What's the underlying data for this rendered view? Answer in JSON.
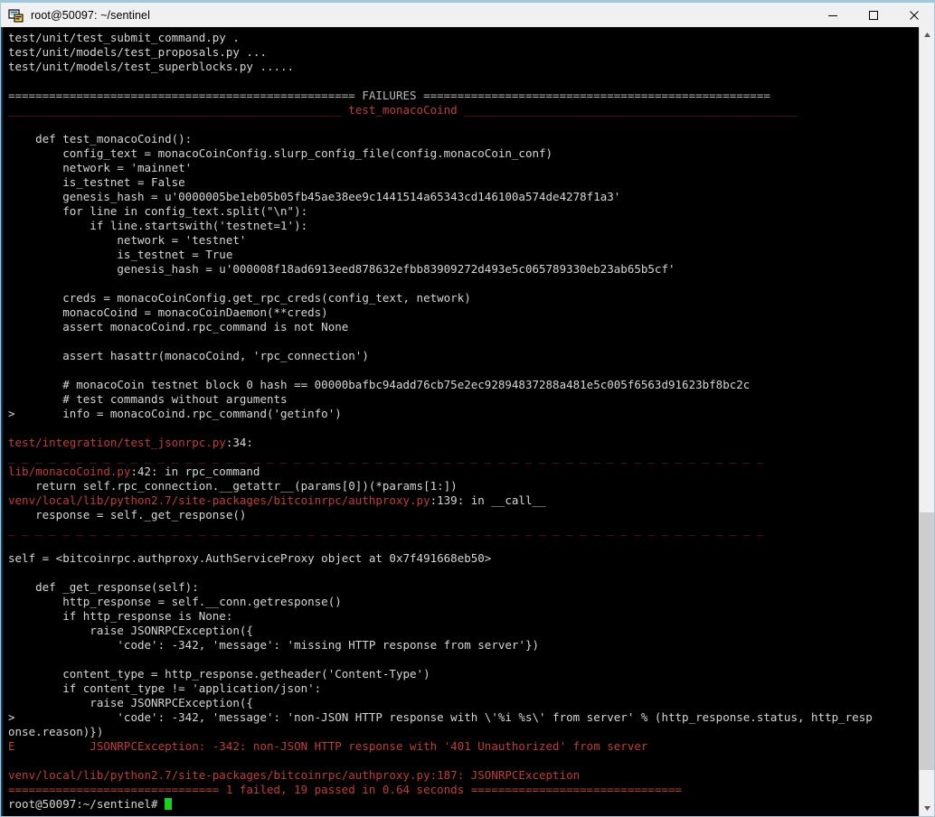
{
  "window": {
    "title": "root@50097: ~/sentinel",
    "icon": "putty-terminal-icon",
    "controls": {
      "minimize": "minimize-button",
      "maximize": "maximize-button",
      "close": "close-button"
    }
  },
  "colors": {
    "background": "#000000",
    "foreground": "#d6d6d6",
    "error_red": "#c23b3b",
    "dark_red": "#8d2626",
    "cursor_green": "#17d217",
    "titlebar": "#f0f0f0",
    "frame_accent": "#9fc8d8"
  },
  "scrollbar": {
    "up_arrow": "scroll-up-arrow-icon",
    "down_arrow": "scroll-down-arrow-icon"
  },
  "terminal": {
    "prompt": "root@50097:~/sentinel#",
    "cursor": "block-cursor",
    "lines": [
      {
        "id": "l01",
        "segments": [
          {
            "text": "test/unit/test_submit_command.py .",
            "class": "fg-white"
          }
        ]
      },
      {
        "id": "l02",
        "segments": [
          {
            "text": "test/unit/models/test_proposals.py ...",
            "class": "fg-white"
          }
        ]
      },
      {
        "id": "l03",
        "segments": [
          {
            "text": "test/unit/models/test_superblocks.py .....",
            "class": "fg-white"
          }
        ]
      },
      {
        "id": "l04",
        "segments": [
          {
            "text": "",
            "class": "fg-white"
          }
        ]
      },
      {
        "id": "l05",
        "segments": [
          {
            "text": "=================================================== FAILURES ===================================================",
            "class": "fg-dim"
          }
        ]
      },
      {
        "id": "l06",
        "segments": [
          {
            "text": "_________________________________________________ ",
            "class": "fg-darkred"
          },
          {
            "text": "test_monacoCoind",
            "class": "fg-red"
          },
          {
            "text": " _________________________________________________",
            "class": "fg-darkred"
          }
        ]
      },
      {
        "id": "l07",
        "segments": [
          {
            "text": "",
            "class": "fg-white"
          }
        ]
      },
      {
        "id": "l08",
        "segments": [
          {
            "text": "    def test_monacoCoind():",
            "class": "fg-white"
          }
        ]
      },
      {
        "id": "l09",
        "segments": [
          {
            "text": "        config_text = monacoCoinConfig.slurp_config_file(config.monacoCoin_conf)",
            "class": "fg-white"
          }
        ]
      },
      {
        "id": "l10",
        "segments": [
          {
            "text": "        network = 'mainnet'",
            "class": "fg-white"
          }
        ]
      },
      {
        "id": "l11",
        "segments": [
          {
            "text": "        is_testnet = False",
            "class": "fg-white"
          }
        ]
      },
      {
        "id": "l12",
        "segments": [
          {
            "text": "        genesis_hash = u'0000005be1eb05b05fb45ae38ee9c1441514a65343cd146100a574de4278f1a3'",
            "class": "fg-white"
          }
        ]
      },
      {
        "id": "l13",
        "segments": [
          {
            "text": "        for line in config_text.split(\"\\n\"):",
            "class": "fg-white"
          }
        ]
      },
      {
        "id": "l14",
        "segments": [
          {
            "text": "            if line.startswith('testnet=1'):",
            "class": "fg-white"
          }
        ]
      },
      {
        "id": "l15",
        "segments": [
          {
            "text": "                network = 'testnet'",
            "class": "fg-white"
          }
        ]
      },
      {
        "id": "l16",
        "segments": [
          {
            "text": "                is_testnet = True",
            "class": "fg-white"
          }
        ]
      },
      {
        "id": "l17",
        "segments": [
          {
            "text": "                genesis_hash = u'000008f18ad6913eed878632efbb83909272d493e5c065789330eb23ab65b5cf'",
            "class": "fg-white"
          }
        ]
      },
      {
        "id": "l18",
        "segments": [
          {
            "text": "",
            "class": "fg-white"
          }
        ]
      },
      {
        "id": "l19",
        "segments": [
          {
            "text": "        creds = monacoCoinConfig.get_rpc_creds(config_text, network)",
            "class": "fg-white"
          }
        ]
      },
      {
        "id": "l20",
        "segments": [
          {
            "text": "        monacoCoind = monacoCoinDaemon(**creds)",
            "class": "fg-white"
          }
        ]
      },
      {
        "id": "l21",
        "segments": [
          {
            "text": "        assert monacoCoind.rpc_command is not None",
            "class": "fg-white"
          }
        ]
      },
      {
        "id": "l22",
        "segments": [
          {
            "text": "",
            "class": "fg-white"
          }
        ]
      },
      {
        "id": "l23",
        "segments": [
          {
            "text": "        assert hasattr(monacoCoind, 'rpc_connection')",
            "class": "fg-white"
          }
        ]
      },
      {
        "id": "l24",
        "segments": [
          {
            "text": "",
            "class": "fg-white"
          }
        ]
      },
      {
        "id": "l25",
        "segments": [
          {
            "text": "        # monacoCoin testnet block 0 hash == 00000bafbc94add76cb75e2ec92894837288a481e5c005f6563d91623bf8bc2c",
            "class": "fg-white"
          }
        ]
      },
      {
        "id": "l26",
        "segments": [
          {
            "text": "        # test commands without arguments",
            "class": "fg-white"
          }
        ]
      },
      {
        "id": "l27",
        "segments": [
          {
            "text": ">       info = monacoCoind.rpc_command('getinfo')",
            "class": "fg-white"
          }
        ]
      },
      {
        "id": "l28",
        "segments": [
          {
            "text": "",
            "class": "fg-white"
          }
        ]
      },
      {
        "id": "l29",
        "segments": [
          {
            "text": "test/integration/test_jsonrpc.py",
            "class": "fg-red"
          },
          {
            "text": ":34: ",
            "class": "fg-white"
          }
        ]
      },
      {
        "id": "l30",
        "segments": [
          {
            "text": "_ _ _ _ _ _ _ _ _ _ _ _ _ _ _ _ _ _ _ _ _ _ _ _ _ _ _ _ _ _ _ _ _ _ _ _ _ _ _ _ _ _ _ _ _ _ _ _ _ _ _ _ _ _ _ _",
            "class": "fg-darkred"
          }
        ]
      },
      {
        "id": "l31",
        "segments": [
          {
            "text": "lib/monacoCoind.py",
            "class": "fg-red"
          },
          {
            "text": ":42: in rpc_command",
            "class": "fg-white"
          }
        ]
      },
      {
        "id": "l32",
        "segments": [
          {
            "text": "    return self.rpc_connection.__getattr__(params[0])(*params[1:])",
            "class": "fg-white"
          }
        ]
      },
      {
        "id": "l33",
        "segments": [
          {
            "text": "venv/local/lib/python2.7/site-packages/bitcoinrpc/authproxy.py",
            "class": "fg-red"
          },
          {
            "text": ":139: in __call__",
            "class": "fg-white"
          }
        ]
      },
      {
        "id": "l34",
        "segments": [
          {
            "text": "    response = self._get_response()",
            "class": "fg-white"
          }
        ]
      },
      {
        "id": "l35",
        "segments": [
          {
            "text": "_ _ _ _ _ _ _ _ _ _ _ _ _ _ _ _ _ _ _ _ _ _ _ _ _ _ _ _ _ _ _ _ _ _ _ _ _ _ _ _ _ _ _ _ _ _ _ _ _ _ _ _ _ _ _ _",
            "class": "fg-darkred"
          }
        ]
      },
      {
        "id": "l36",
        "segments": [
          {
            "text": "",
            "class": "fg-white"
          }
        ]
      },
      {
        "id": "l37",
        "segments": [
          {
            "text": "self = <bitcoinrpc.authproxy.AuthServiceProxy object at 0x7f491668eb50>",
            "class": "fg-white"
          }
        ]
      },
      {
        "id": "l38",
        "segments": [
          {
            "text": "",
            "class": "fg-white"
          }
        ]
      },
      {
        "id": "l39",
        "segments": [
          {
            "text": "    def _get_response(self):",
            "class": "fg-white"
          }
        ]
      },
      {
        "id": "l40",
        "segments": [
          {
            "text": "        http_response = self.__conn.getresponse()",
            "class": "fg-white"
          }
        ]
      },
      {
        "id": "l41",
        "segments": [
          {
            "text": "        if http_response is None:",
            "class": "fg-white"
          }
        ]
      },
      {
        "id": "l42",
        "segments": [
          {
            "text": "            raise JSONRPCException({",
            "class": "fg-white"
          }
        ]
      },
      {
        "id": "l43",
        "segments": [
          {
            "text": "                'code': -342, 'message': 'missing HTTP response from server'})",
            "class": "fg-white"
          }
        ]
      },
      {
        "id": "l44",
        "segments": [
          {
            "text": "",
            "class": "fg-white"
          }
        ]
      },
      {
        "id": "l45",
        "segments": [
          {
            "text": "        content_type = http_response.getheader('Content-Type')",
            "class": "fg-white"
          }
        ]
      },
      {
        "id": "l46",
        "segments": [
          {
            "text": "        if content_type != 'application/json':",
            "class": "fg-white"
          }
        ]
      },
      {
        "id": "l47",
        "segments": [
          {
            "text": "            raise JSONRPCException({",
            "class": "fg-white"
          }
        ]
      },
      {
        "id": "l48",
        "segments": [
          {
            "text": ">               'code': -342, 'message': 'non-JSON HTTP response with \\'%i %s\\' from server' % (http_response.status, http_resp",
            "class": "fg-white"
          }
        ]
      },
      {
        "id": "l49",
        "segments": [
          {
            "text": "onse.reason)})",
            "class": "fg-white"
          }
        ]
      },
      {
        "id": "l50",
        "segments": [
          {
            "text": "E           JSONRPCException: -342: non-JSON HTTP response with '401 Unauthorized' from server",
            "class": "fg-red"
          }
        ]
      },
      {
        "id": "l51",
        "segments": [
          {
            "text": "",
            "class": "fg-white"
          }
        ]
      },
      {
        "id": "l52",
        "segments": [
          {
            "text": "venv/local/lib/python2.7/site-packages/bitcoinrpc/authproxy.py:187: JSONRPCException",
            "class": "fg-red"
          }
        ]
      },
      {
        "id": "l53",
        "segments": [
          {
            "text": "=============================== 1 failed, 19 passed in 0.64 seconds ===============================",
            "class": "fg-red"
          }
        ]
      }
    ],
    "prompt_line": {
      "text": "root@50097:~/sentinel# ",
      "class": "fg-white"
    }
  }
}
